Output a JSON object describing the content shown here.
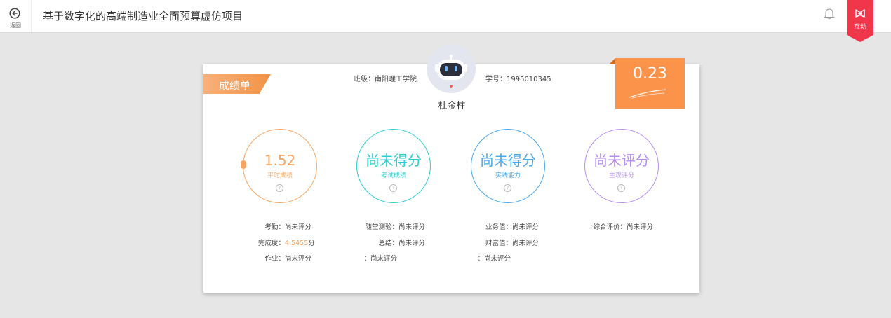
{
  "header": {
    "back_label": "返回",
    "title": "基于数字化的高端制造业全面预算虚仿项目",
    "interact_label": "互动",
    "accent": "#f0364a"
  },
  "card": {
    "tag": "成绩单",
    "class_label": "班级：",
    "class_value": "南阳理工学院",
    "student_no_label": "学号：",
    "student_no_value": "1995010345",
    "student_name": "杜金柱",
    "total_score": "0.23"
  },
  "circles": [
    {
      "value": "1.52",
      "label": "平时成绩",
      "color": "#f9a560"
    },
    {
      "value": "尚未得分",
      "label": "考试成绩",
      "color": "#2ccfd0"
    },
    {
      "value": "尚未得分",
      "label": "实践能力",
      "color": "#48a9ef"
    },
    {
      "value": "尚未评分",
      "label": "主观评分",
      "color": "#b48cf3"
    }
  ],
  "details": {
    "col1": [
      {
        "key": "考勤：",
        "value": "尚未评分"
      },
      {
        "key": "完成度：",
        "value": "4.5455",
        "suffix": "分"
      },
      {
        "key": "作业：",
        "value": "尚未评分"
      }
    ],
    "col2": [
      {
        "key": "随堂测验：",
        "value": "尚未评分"
      },
      {
        "key": "总结：",
        "value": "尚未评分"
      },
      {
        "key": "：",
        "value": "尚未评分"
      }
    ],
    "col3": [
      {
        "key": "业务值：",
        "value": "尚未评分"
      },
      {
        "key": "财富值：",
        "value": "尚未评分"
      },
      {
        "key": "：",
        "value": "尚未评分"
      }
    ],
    "col4": [
      {
        "key": "综合评价：",
        "value": "尚未评分"
      }
    ]
  },
  "icons": {
    "back": "arrow-left-circle-icon",
    "bell": "bell-icon",
    "interact": "interact-icon",
    "question": "question-icon",
    "avatar": "robot-avatar-icon"
  }
}
